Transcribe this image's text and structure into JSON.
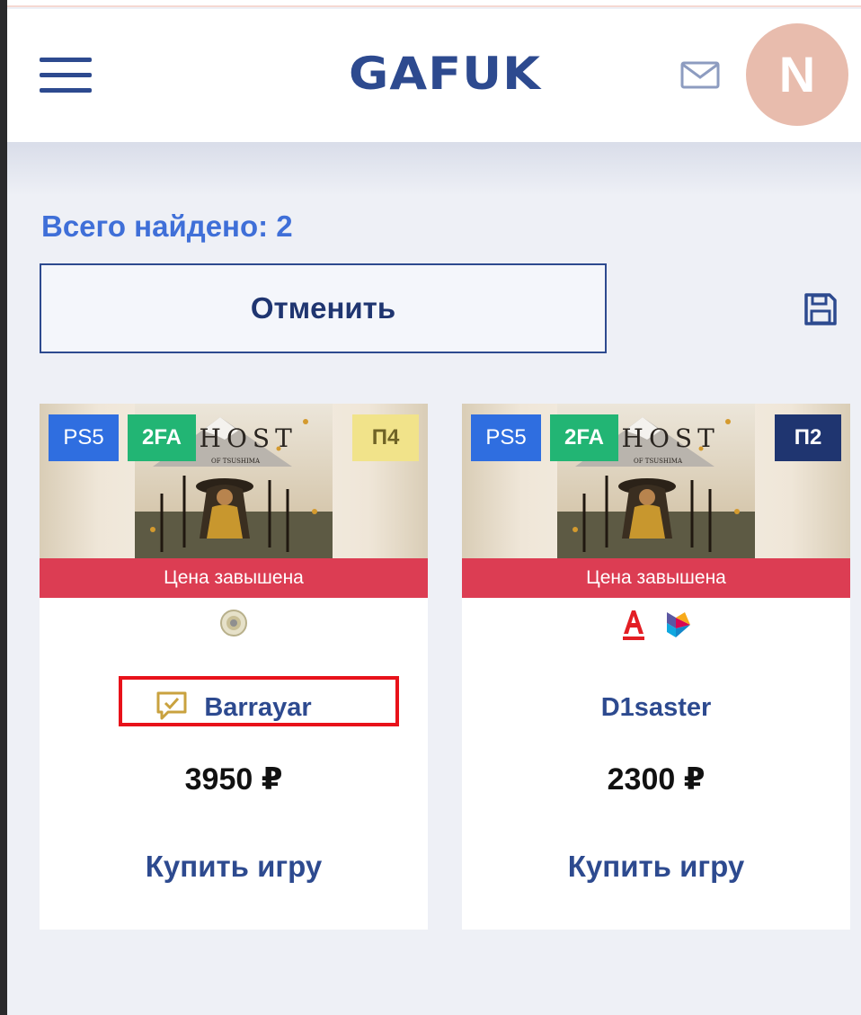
{
  "header": {
    "logo": "GAFUK",
    "avatar_letter": "N",
    "icons": [
      "menu-icon",
      "mail-icon"
    ],
    "colors": {
      "brand": "#2d4a8f",
      "avatar_bg": "#e8bcad"
    }
  },
  "results": {
    "found_text": "Всего найдено: 2",
    "cancel_label": "Отменить",
    "save_icon": "floppy-disk-icon"
  },
  "cards": [
    {
      "platform": "PS5",
      "security": "2FA",
      "position": "П4",
      "position_color": "#f1e38a",
      "cover_title": "GHOST",
      "cover_subtitle": "OF TSUSHIMA",
      "price_flag": "Цена завышена",
      "payment_icons": [
        "coin-badge-icon"
      ],
      "seller": "Barrayar",
      "seller_icon": "chat-check-icon",
      "price": "3950 ₽",
      "buy_label": "Купить игру"
    },
    {
      "platform": "PS5",
      "security": "2FA",
      "position": "П2",
      "position_color": "#1f3570",
      "cover_title": "GHOST",
      "cover_subtitle": "OF TSUSHIMA",
      "price_flag": "Цена завышена",
      "payment_icons": [
        "alfa-bank-icon",
        "sbp-icon"
      ],
      "seller": "D1saster",
      "price": "2300 ₽",
      "buy_label": "Купить игру"
    }
  ]
}
